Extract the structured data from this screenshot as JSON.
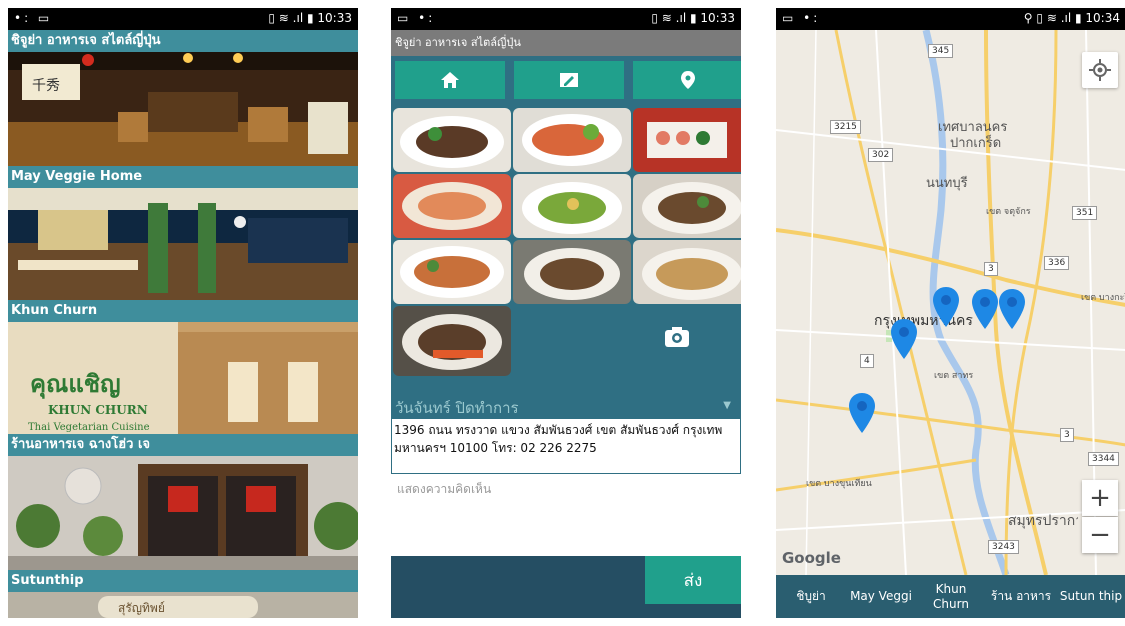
{
  "status": {
    "time1": "10:33",
    "time2": "10:33",
    "time3": "10:34"
  },
  "list": {
    "items": [
      {
        "title": "ชิจูย่า อาหารเจ สไตล์ญี่ปุ่น"
      },
      {
        "title": "May Veggie Home"
      },
      {
        "title": "Khun Churn"
      },
      {
        "title": "ร้านอาหารเจ ฉางโฮ่ว เจ"
      },
      {
        "title": "Sutunthip"
      }
    ]
  },
  "detail": {
    "title": "ชิจูย่า อาหารเจ สไตล์ญี่ปุ่น",
    "nav": [
      "home-icon",
      "edit-icon",
      "location-icon"
    ],
    "hours": "วันจันทร์ ปิดทำการ",
    "address": "1396 ถนน ทรงวาด แขวง สัมพันธวงศ์ เขต สัมพันธวงศ์ กรุงเทพมหานครฯ 10100  โทร: 02 226 2275",
    "comment_placeholder": "แสดงความคิดเห็น",
    "send_label": "ส่ง"
  },
  "map": {
    "labels": {
      "city1": "เทศบาลนคร",
      "city2": "ปากเกร็ด",
      "nonthaburi": "นนทบุรี",
      "chatuchak": "เขต จตุจักร",
      "bangkok": "กรุงเทพมหานคร",
      "samran": "เขต สาทร",
      "bangkhuntien": "เขต บางขุนเทียน",
      "samutprakan": "สมุทรปราการ",
      "bangkapi": "เขต บางกะปิ"
    },
    "shields": [
      "345",
      "3215",
      "302",
      "351",
      "3",
      "336",
      "4",
      "3",
      "3344",
      "3243"
    ],
    "google": "Google",
    "tabs": [
      "ชิบูย่า",
      "May Veggi",
      "Khun Churn",
      "ร้าน อาหาร",
      "Sutun thip"
    ]
  },
  "colors": {
    "teal": "#20a08c",
    "header": "#3f8e9c",
    "dark": "#254e63",
    "pin": "#1e88e5"
  }
}
